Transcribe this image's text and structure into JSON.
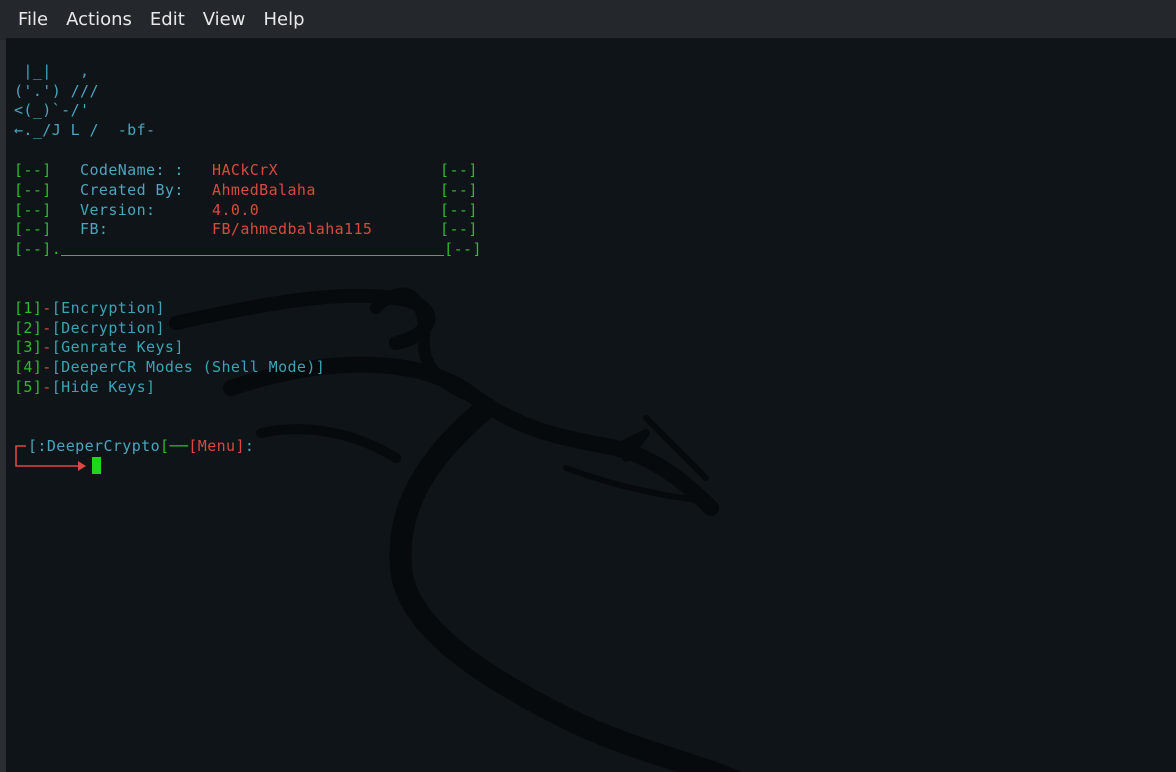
{
  "menu": [
    "File",
    "Actions",
    "Edit",
    "View",
    "Help"
  ],
  "banner": {
    "art": [
      " |_|   ,",
      "('.') ///",
      "<(_)`-/'",
      "←._/J L /  -bf-"
    ]
  },
  "info": {
    "bracket": "[--]",
    "last_bracket": "[--].",
    "rows": [
      {
        "label": "CodeName: :",
        "value": "HACkCrX"
      },
      {
        "label": "Created By:",
        "value": "AhmedBalaha"
      },
      {
        "label": "Version:",
        "value": "4.0.0"
      },
      {
        "label": "FB:",
        "value": "FB/ahmedbalaha115"
      }
    ]
  },
  "options": [
    {
      "num": "[1]",
      "label": "[Encryption]"
    },
    {
      "num": "[2]",
      "label": "[Decryption]"
    },
    {
      "num": "[3]",
      "label": "[Genrate Keys]"
    },
    {
      "num": "[4]",
      "label": "[DeeperCR Modes (Shell Mode)]"
    },
    {
      "num": "[5]",
      "label": "[Hide Keys]"
    }
  ],
  "prompt": {
    "name": "[:DeeperCrypto",
    "sep": "[──",
    "menu": "[Menu]",
    "end": ":"
  },
  "colors": {
    "background": "#0f1418",
    "cyan": "#4aa5bd",
    "green": "#2cbc2c",
    "red": "#d9493f",
    "cursor": "#1bd81b"
  }
}
